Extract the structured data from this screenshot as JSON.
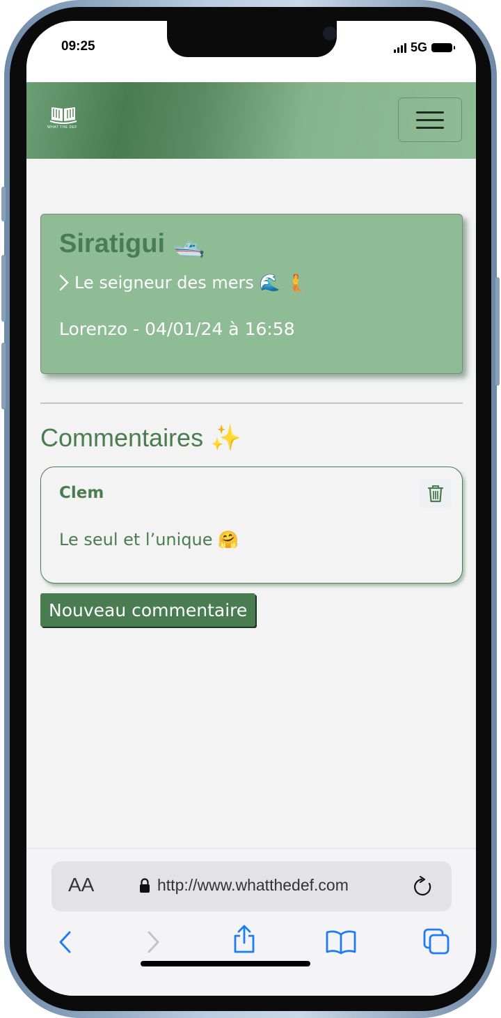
{
  "status_bar": {
    "time": "09:25",
    "network": "5G"
  },
  "navbar": {
    "logo_text": "WHAT THE DEF"
  },
  "definition": {
    "title": "Siratigui 🛥️",
    "definition_text": "Le seigneur des mers 🌊 🧜",
    "meta": "Lorenzo - 04/01/24 à 16:58"
  },
  "comments": {
    "heading": "Commentaires ✨",
    "items": [
      {
        "author": "Clem",
        "text": "Le seul et l’unique 🤗"
      }
    ],
    "new_comment_label": "Nouveau commentaire"
  },
  "browser": {
    "aa_label": "AA",
    "url": "http://www.whatthedef.com"
  },
  "colors": {
    "brand_green": "#4a7c51",
    "card_green": "#8fbc95",
    "ios_blue": "#1e7cf2"
  }
}
